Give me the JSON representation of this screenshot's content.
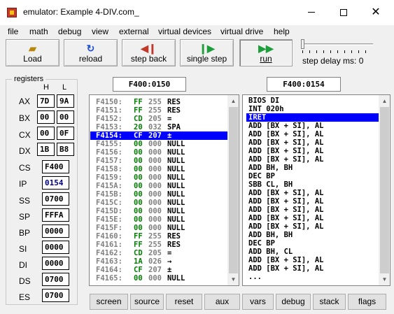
{
  "window": {
    "title": "emulator: Example 4-DIV.com_",
    "minimize": "—",
    "maximize": "☐",
    "close": "✕"
  },
  "menu": [
    "file",
    "math",
    "debug",
    "view",
    "external",
    "virtual devices",
    "virtual drive",
    "help"
  ],
  "toolbar": {
    "load": {
      "label": "Load",
      "icon": "folder-open-icon"
    },
    "reload": {
      "label": "reload",
      "icon": "reload-icon"
    },
    "step_back": {
      "label": "step back",
      "icon": "step-back-icon"
    },
    "single_step": {
      "label": "single step",
      "icon": "single-step-icon"
    },
    "run": {
      "label": "run",
      "icon": "run-icon"
    },
    "step_delay": "step delay ms: 0"
  },
  "registers": {
    "title": "registers",
    "col_h": "H",
    "col_l": "L",
    "byte_regs": [
      {
        "name": "AX",
        "h": "7D",
        "l": "9A"
      },
      {
        "name": "BX",
        "h": "00",
        "l": "00"
      },
      {
        "name": "CX",
        "h": "00",
        "l": "0F"
      },
      {
        "name": "DX",
        "h": "1B",
        "l": "B8"
      }
    ],
    "word_regs": [
      {
        "name": "CS",
        "value": "F400"
      },
      {
        "name": "IP",
        "value": "0154"
      },
      {
        "name": "SS",
        "value": "0700"
      },
      {
        "name": "SP",
        "value": "FFFA"
      },
      {
        "name": "BP",
        "value": "0000"
      },
      {
        "name": "SI",
        "value": "0000"
      },
      {
        "name": "DI",
        "value": "0000"
      },
      {
        "name": "DS",
        "value": "0700"
      },
      {
        "name": "ES",
        "value": "0700"
      }
    ]
  },
  "memory": {
    "address": "F400:0150",
    "selected_index": 4,
    "rows": [
      {
        "addr": "F4150:",
        "hex": "FF",
        "dec": "255",
        "chr": "RES"
      },
      {
        "addr": "F4151:",
        "hex": "FF",
        "dec": "255",
        "chr": "RES"
      },
      {
        "addr": "F4152:",
        "hex": "CD",
        "dec": "205",
        "chr": "="
      },
      {
        "addr": "F4153:",
        "hex": "20",
        "dec": "032",
        "chr": "SPA"
      },
      {
        "addr": "F4154:",
        "hex": "CF",
        "dec": "207",
        "chr": "±"
      },
      {
        "addr": "F4155:",
        "hex": "00",
        "dec": "000",
        "chr": "NULL"
      },
      {
        "addr": "F4156:",
        "hex": "00",
        "dec": "000",
        "chr": "NULL"
      },
      {
        "addr": "F4157:",
        "hex": "00",
        "dec": "000",
        "chr": "NULL"
      },
      {
        "addr": "F4158:",
        "hex": "00",
        "dec": "000",
        "chr": "NULL"
      },
      {
        "addr": "F4159:",
        "hex": "00",
        "dec": "000",
        "chr": "NULL"
      },
      {
        "addr": "F415A:",
        "hex": "00",
        "dec": "000",
        "chr": "NULL"
      },
      {
        "addr": "F415B:",
        "hex": "00",
        "dec": "000",
        "chr": "NULL"
      },
      {
        "addr": "F415C:",
        "hex": "00",
        "dec": "000",
        "chr": "NULL"
      },
      {
        "addr": "F415D:",
        "hex": "00",
        "dec": "000",
        "chr": "NULL"
      },
      {
        "addr": "F415E:",
        "hex": "00",
        "dec": "000",
        "chr": "NULL"
      },
      {
        "addr": "F415F:",
        "hex": "00",
        "dec": "000",
        "chr": "NULL"
      },
      {
        "addr": "F4160:",
        "hex": "FF",
        "dec": "255",
        "chr": "RES"
      },
      {
        "addr": "F4161:",
        "hex": "FF",
        "dec": "255",
        "chr": "RES"
      },
      {
        "addr": "F4162:",
        "hex": "CD",
        "dec": "205",
        "chr": "="
      },
      {
        "addr": "F4163:",
        "hex": "1A",
        "dec": "026",
        "chr": "→"
      },
      {
        "addr": "F4164:",
        "hex": "CF",
        "dec": "207",
        "chr": "±"
      },
      {
        "addr": "F4165:",
        "hex": "00",
        "dec": "000",
        "chr": "NULL"
      }
    ]
  },
  "disassembly": {
    "address": "F400:0154",
    "selected_index": 2,
    "lines": [
      "BIOS DI",
      "INT 020h",
      "IRET",
      "ADD [BX + SI], AL",
      "ADD [BX + SI], AL",
      "ADD [BX + SI], AL",
      "ADD [BX + SI], AL",
      "ADD [BX + SI], AL",
      "ADD BH, BH",
      "DEC BP",
      "SBB CL, BH",
      "ADD [BX + SI], AL",
      "ADD [BX + SI], AL",
      "ADD [BX + SI], AL",
      "ADD [BX + SI], AL",
      "ADD [BX + SI], AL",
      "ADD BH, BH",
      "DEC BP",
      "ADD BH, CL",
      "ADD [BX + SI], AL",
      "ADD [BX + SI], AL",
      "..."
    ]
  },
  "bottom_buttons": [
    "screen",
    "source",
    "reset",
    "aux",
    "vars",
    "debug",
    "stack",
    "flags"
  ]
}
